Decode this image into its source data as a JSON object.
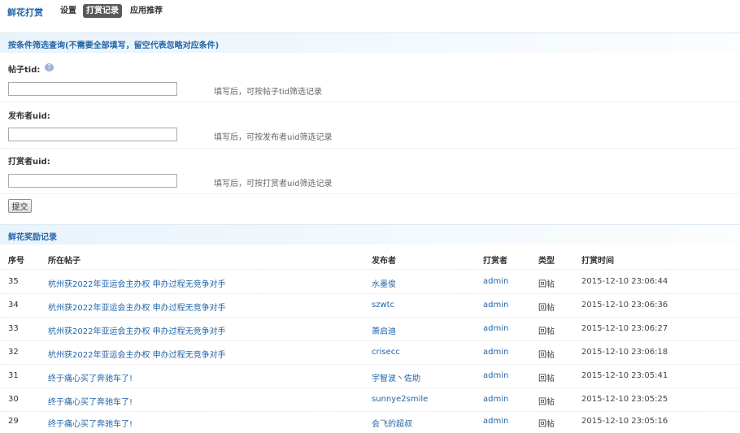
{
  "nav": {
    "brand": "鲜花打赏",
    "tabs": [
      {
        "label": "设置",
        "active": false
      },
      {
        "label": "打赏记录",
        "active": true
      },
      {
        "label": "应用推荐",
        "active": false
      }
    ]
  },
  "filter": {
    "header": "按条件筛选查询(不需要全部填写，留空代表忽略对应条件)",
    "help_glyph": "?",
    "fields": [
      {
        "label": "帖子tid:",
        "value": "",
        "hint": "填写后，可按帖子tid筛选记录"
      },
      {
        "label": "发布者uid:",
        "value": "",
        "hint": "填写后，可按发布者uid筛选记录"
      },
      {
        "label": "打赏者uid:",
        "value": "",
        "hint": "填写后，可按打赏者uid筛选记录"
      }
    ],
    "submit_label": "提交"
  },
  "records": {
    "header": "鲜花奖励记录",
    "columns": [
      "序号",
      "所在帖子",
      "发布者",
      "打赏者",
      "类型",
      "打赏时间"
    ],
    "rows": [
      {
        "no": "35",
        "thread": "杭州获2022年亚运会主办权 申办过程无竞争对手",
        "author": "水墨俊",
        "tipper": "admin",
        "type": "回帖",
        "time": "2015-12-10 23:06:44"
      },
      {
        "no": "34",
        "thread": "杭州获2022年亚运会主办权 申办过程无竞争对手",
        "author": "szwtc",
        "tipper": "admin",
        "type": "回帖",
        "time": "2015-12-10 23:06:36"
      },
      {
        "no": "33",
        "thread": "杭州获2022年亚运会主办权 申办过程无竞争对手",
        "author": "萧启迪",
        "tipper": "admin",
        "type": "回帖",
        "time": "2015-12-10 23:06:27"
      },
      {
        "no": "32",
        "thread": "杭州获2022年亚运会主办权 申办过程无竞争对手",
        "author": "crisecc",
        "tipper": "admin",
        "type": "回帖",
        "time": "2015-12-10 23:06:18"
      },
      {
        "no": "31",
        "thread": "终于痛心买了奔驰车了!",
        "author": "宇智波丶佐助",
        "tipper": "admin",
        "type": "回帖",
        "time": "2015-12-10 23:05:41"
      },
      {
        "no": "30",
        "thread": "终于痛心买了奔驰车了!",
        "author": "sunnye2smile",
        "tipper": "admin",
        "type": "回帖",
        "time": "2015-12-10 23:05:25"
      },
      {
        "no": "29",
        "thread": "终于痛心买了奔驰车了!",
        "author": "会飞的超叔",
        "tipper": "admin",
        "type": "回帖",
        "time": "2015-12-10 23:05:16"
      }
    ]
  },
  "colors": {
    "link": "#2366A8",
    "active_tab_bg": "#5a5a5a",
    "header_bar": "#e9f3fb"
  }
}
